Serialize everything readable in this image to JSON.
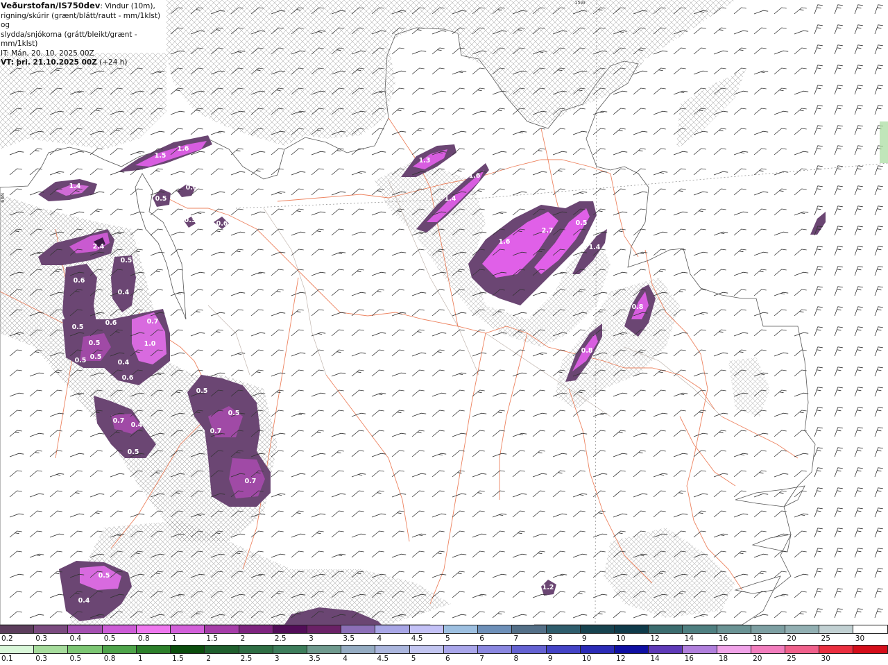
{
  "header": {
    "title": "Veðurstofan/IS750dev",
    "title_suffix": ": Vindur (10m),",
    "line2": "rigning/skúrir (grænt/blátt/rautt - mm/1klst) og",
    "line3": "slydda/snjókoma (grátt/bleikt/grænt - mm/1klst)",
    "init_time": "IT: Mán. 20. 10. 2025 00Z",
    "valid_time": "VT: þri. 21.10.2025 00Z",
    "lead": " (+24 h)"
  },
  "edge_labels": {
    "top": "15W",
    "left": "66N"
  },
  "precip_values": [
    {
      "id": "v1",
      "text": "1.4"
    },
    {
      "id": "v2",
      "text": "1.5"
    },
    {
      "id": "v3",
      "text": "1.6"
    },
    {
      "id": "v4",
      "text": "0.5"
    },
    {
      "id": "v5",
      "text": "0.6"
    },
    {
      "id": "v6",
      "text": "0.3"
    },
    {
      "id": "v7",
      "text": "0.6"
    },
    {
      "id": "v8",
      "text": "2.4"
    },
    {
      "id": "v9",
      "text": "0.5"
    },
    {
      "id": "v10",
      "text": "0.6"
    },
    {
      "id": "v11",
      "text": "0.4"
    },
    {
      "id": "v12",
      "text": "0.7"
    },
    {
      "id": "v13",
      "text": "0.5"
    },
    {
      "id": "v14",
      "text": "0.6"
    },
    {
      "id": "v15",
      "text": "1.0"
    },
    {
      "id": "v16",
      "text": "0.5"
    },
    {
      "id": "v17",
      "text": "0.5"
    },
    {
      "id": "v18",
      "text": "0.5"
    },
    {
      "id": "v19",
      "text": "0.4"
    },
    {
      "id": "v20",
      "text": "0.6"
    },
    {
      "id": "v21",
      "text": "0.5"
    },
    {
      "id": "v22",
      "text": "0.5"
    },
    {
      "id": "v23",
      "text": "0.7"
    },
    {
      "id": "v24",
      "text": "0.7"
    },
    {
      "id": "v25",
      "text": "0.4"
    },
    {
      "id": "v26",
      "text": "0.5"
    },
    {
      "id": "v27",
      "text": "0.7"
    },
    {
      "id": "v28",
      "text": "1.3"
    },
    {
      "id": "v29",
      "text": "1.6"
    },
    {
      "id": "v30",
      "text": "1.4"
    },
    {
      "id": "v31",
      "text": "1.6"
    },
    {
      "id": "v32",
      "text": "2.7"
    },
    {
      "id": "v33",
      "text": "0.5"
    },
    {
      "id": "v34",
      "text": "1.4"
    },
    {
      "id": "v35",
      "text": "0.8"
    },
    {
      "id": "v36",
      "text": "0.8"
    },
    {
      "id": "v37",
      "text": "0.5"
    },
    {
      "id": "v38",
      "text": "0.4"
    },
    {
      "id": "v39",
      "text": "1.2"
    }
  ],
  "legend_snow": {
    "labels": [
      "0.2",
      "0.3",
      "0.4",
      "0.5",
      "0.8",
      "1",
      "1.5",
      "2",
      "2.5",
      "3",
      "3.5",
      "4",
      "4.5",
      "5",
      "6",
      "7",
      "8",
      "9",
      "10",
      "12",
      "14",
      "16",
      "18",
      "20",
      "25",
      "30"
    ],
    "colors": [
      "#5c3d5c",
      "#7a4a7f",
      "#a44fb0",
      "#cc5bd6",
      "#ee77ee",
      "#d25fd9",
      "#a53ca8",
      "#7e237f",
      "#520d58",
      "#6a2166",
      "#8c6fb7",
      "#a8a6e6",
      "#c3c1f6",
      "#9dbfe0",
      "#6d8fb8",
      "#536f87",
      "#2e5d6c",
      "#17434f",
      "#0f3b4a",
      "#3b6c6e",
      "#4e7f80",
      "#6a9394",
      "#7d9fa2",
      "#92afb2",
      "#c1d0d2",
      "#ffffff"
    ]
  },
  "legend_rain": {
    "labels": [
      "0.1",
      "0.3",
      "0.5",
      "0.8",
      "1",
      "1.5",
      "2",
      "2.5",
      "3",
      "3.5",
      "4",
      "4.5",
      "5",
      "6",
      "7",
      "8",
      "9",
      "10",
      "12",
      "14",
      "16",
      "18",
      "20",
      "25",
      "30"
    ],
    "colors": [
      "#d9f7d9",
      "#a6dc9c",
      "#7cc673",
      "#4ea44a",
      "#2c7f2a",
      "#0b4d0d",
      "#1f5f2d",
      "#2e6e44",
      "#3d7d5b",
      "#6f9a8e",
      "#95acc2",
      "#abb6dd",
      "#c2c5f0",
      "#a9a6ea",
      "#8a87e0",
      "#6462d2",
      "#4443c6",
      "#2b2bb7",
      "#0f0fa3",
      "#5e3ab8",
      "#b07fdc",
      "#f0a3e8",
      "#f27dbd",
      "#f0608b",
      "#ea2e3f",
      "#d40e1a"
    ]
  }
}
